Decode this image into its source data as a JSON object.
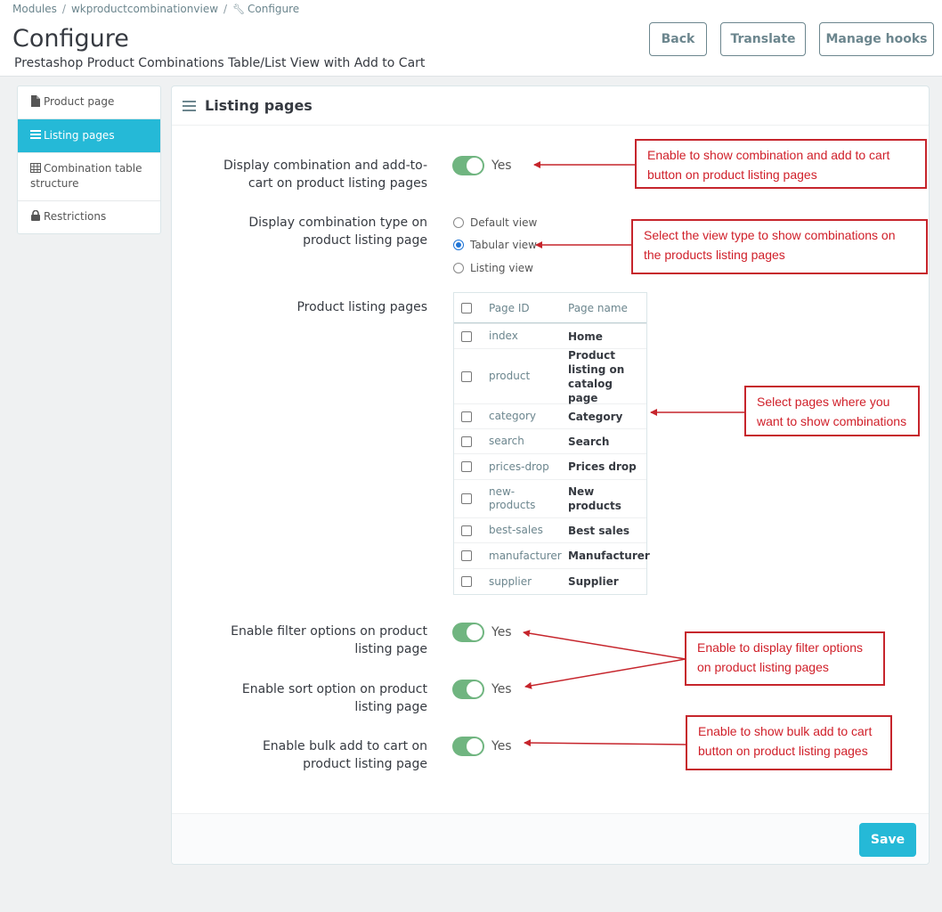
{
  "breadcrumb": {
    "items": [
      "Modules",
      "wkproductcombinationview",
      "Configure"
    ]
  },
  "header": {
    "title": "Configure",
    "subtitle": "Prestashop Product Combinations Table/List View with Add to Cart",
    "buttons": {
      "back": "Back",
      "translate": "Translate",
      "manage_hooks": "Manage hooks"
    }
  },
  "sidebar": {
    "items": [
      {
        "label": "Product page",
        "icon": "file-icon"
      },
      {
        "label": "Listing pages",
        "icon": "list-icon",
        "active": true
      },
      {
        "label": "Combination table structure",
        "icon": "table-icon"
      },
      {
        "label": "Restrictions",
        "icon": "lock-icon"
      }
    ]
  },
  "panel": {
    "title": "Listing pages",
    "fields": {
      "display_combination": {
        "label": "Display combination and add-to-cart on product listing pages",
        "value": "Yes"
      },
      "display_type": {
        "label": "Display combination type on product listing page",
        "options": [
          "Default view",
          "Tabular view",
          "Listing view"
        ],
        "selected": "Tabular view"
      },
      "listing_pages": {
        "label": "Product listing pages",
        "columns": [
          "Page ID",
          "Page name"
        ],
        "rows": [
          {
            "id": "index",
            "name": "Home"
          },
          {
            "id": "product",
            "name": "Product listing on catalog page"
          },
          {
            "id": "category",
            "name": "Category"
          },
          {
            "id": "search",
            "name": "Search"
          },
          {
            "id": "prices-drop",
            "name": "Prices drop"
          },
          {
            "id": "new-products",
            "name": "New products"
          },
          {
            "id": "best-sales",
            "name": "Best sales"
          },
          {
            "id": "manufacturer",
            "name": "Manufacturer"
          },
          {
            "id": "supplier",
            "name": "Supplier"
          }
        ]
      },
      "filter_options": {
        "label": "Enable filter options on product listing page",
        "value": "Yes"
      },
      "sort_option": {
        "label": "Enable sort option on product listing page",
        "value": "Yes"
      },
      "bulk_add": {
        "label": "Enable bulk add to cart on product listing page",
        "value": "Yes"
      }
    },
    "save_label": "Save"
  },
  "annotations": {
    "a1": "Enable to show combination and add to cart button on product listing pages",
    "a2": "Select the view type to show combinations on the products listing pages",
    "a3": "Select pages where you want to show combinations",
    "a4": "Enable to display filter options on product listing pages",
    "a5": "Enable to show bulk add to cart button on product listing pages"
  },
  "colors": {
    "accent": "#25b9d7",
    "switch_on": "#70b580",
    "annotation": "#c6252c"
  }
}
